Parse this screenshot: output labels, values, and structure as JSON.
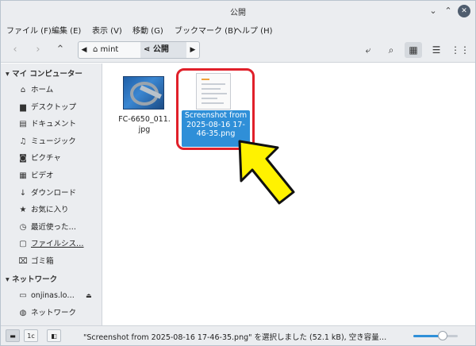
{
  "window": {
    "title": "公開"
  },
  "menubar": [
    "ファイル (F)",
    "編集 (E)",
    "表示 (V)",
    "移動 (G)",
    "ブックマーク (B)",
    "ヘルプ (H)"
  ],
  "breadcrumb": {
    "parent": "mint",
    "current": "公開"
  },
  "sidebar": {
    "section1": "マイ コンピューター",
    "items": [
      {
        "label": "ホーム",
        "icon": "home-icon",
        "glyph": "⌂"
      },
      {
        "label": "デスクトップ",
        "icon": "desktop-folder-icon",
        "glyph": "▆"
      },
      {
        "label": "ドキュメント",
        "icon": "document-icon",
        "glyph": "▤"
      },
      {
        "label": "ミュージック",
        "icon": "music-icon",
        "glyph": "♫"
      },
      {
        "label": "ピクチャ",
        "icon": "pictures-icon",
        "glyph": "◙"
      },
      {
        "label": "ビデオ",
        "icon": "video-icon",
        "glyph": "▦"
      },
      {
        "label": "ダウンロード",
        "icon": "download-icon",
        "glyph": "↓"
      },
      {
        "label": "お気に入り",
        "icon": "star-icon",
        "glyph": "★"
      },
      {
        "label": "最近使った…",
        "icon": "recent-icon",
        "glyph": "◷"
      },
      {
        "label": "ファイルシス…",
        "icon": "filesystem-icon",
        "glyph": "▢"
      },
      {
        "label": "ゴミ箱",
        "icon": "trash-icon",
        "glyph": "⌧"
      }
    ],
    "section2": "ネットワーク",
    "network": [
      {
        "label": "onjinas.lo…",
        "icon": "network-drive-icon",
        "glyph": "▭"
      },
      {
        "label": "ネットワーク",
        "icon": "network-icon",
        "glyph": "◍"
      }
    ]
  },
  "files": [
    {
      "name": "FC-6650_011.\njpg",
      "selected": false
    },
    {
      "name": "Screenshot from\n2025-08-16 17-\n46-35.png",
      "selected": true
    }
  ],
  "status": {
    "text": "\"Screenshot from 2025-08-16 17-46-35.png\" を選択しました (52.1 kB), 空き容量…",
    "zoom_fraction": 0.66
  },
  "colors": {
    "accent": "#2f8fd8",
    "highlight": "#e0202a",
    "arrow": "#fff200"
  }
}
